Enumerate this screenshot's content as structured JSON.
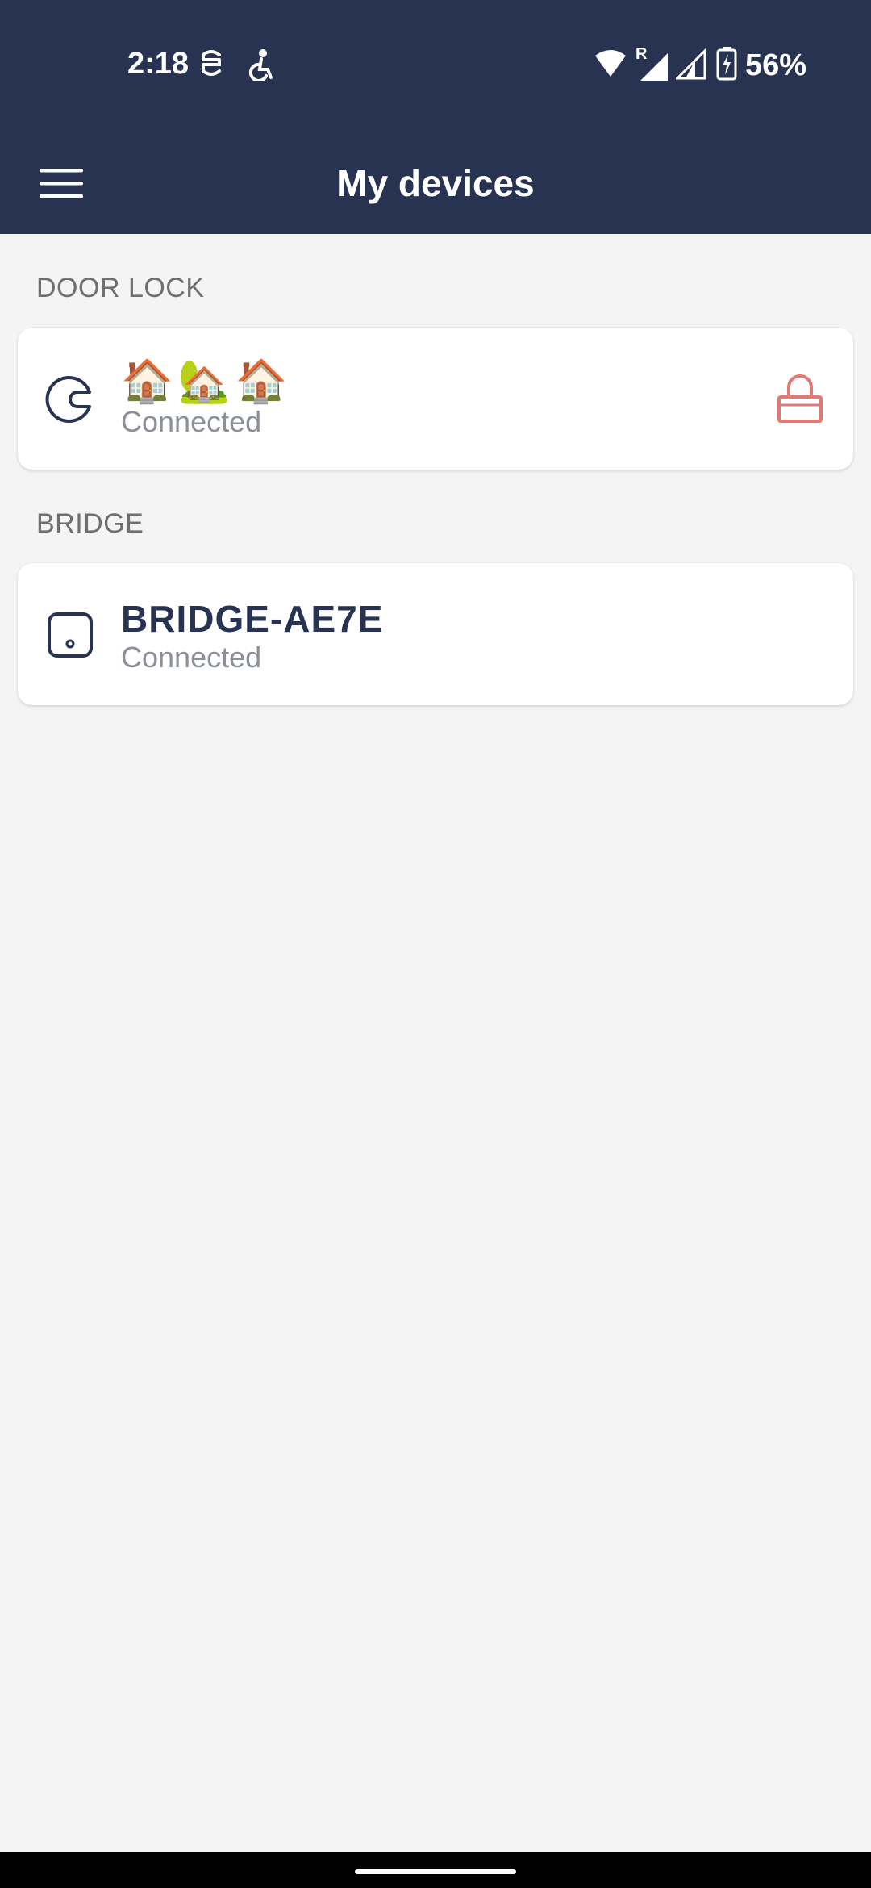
{
  "status_bar": {
    "time": "2:18",
    "battery": "56%",
    "roaming_label": "R",
    "icons": [
      "s-icon",
      "accessibility-icon",
      "wifi-icon",
      "signal-icon",
      "signal-icon",
      "battery-charging-icon"
    ]
  },
  "app_bar": {
    "title": "My devices",
    "menu_icon": "hamburger-menu-icon"
  },
  "sections": [
    {
      "header": "DOOR LOCK",
      "device": {
        "name": "🏠🏡🏠",
        "status": "Connected",
        "icon": "door-lock-device-icon",
        "action_icon": "lock-icon"
      }
    },
    {
      "header": "BRIDGE",
      "device": {
        "name": "BRIDGE-AE7E",
        "status": "Connected",
        "icon": "bridge-device-icon"
      }
    }
  ],
  "colors": {
    "primary": "#283352",
    "background": "#f4f4f4",
    "lock_accent": "#e07a72",
    "status_text": "#8a8f98"
  }
}
